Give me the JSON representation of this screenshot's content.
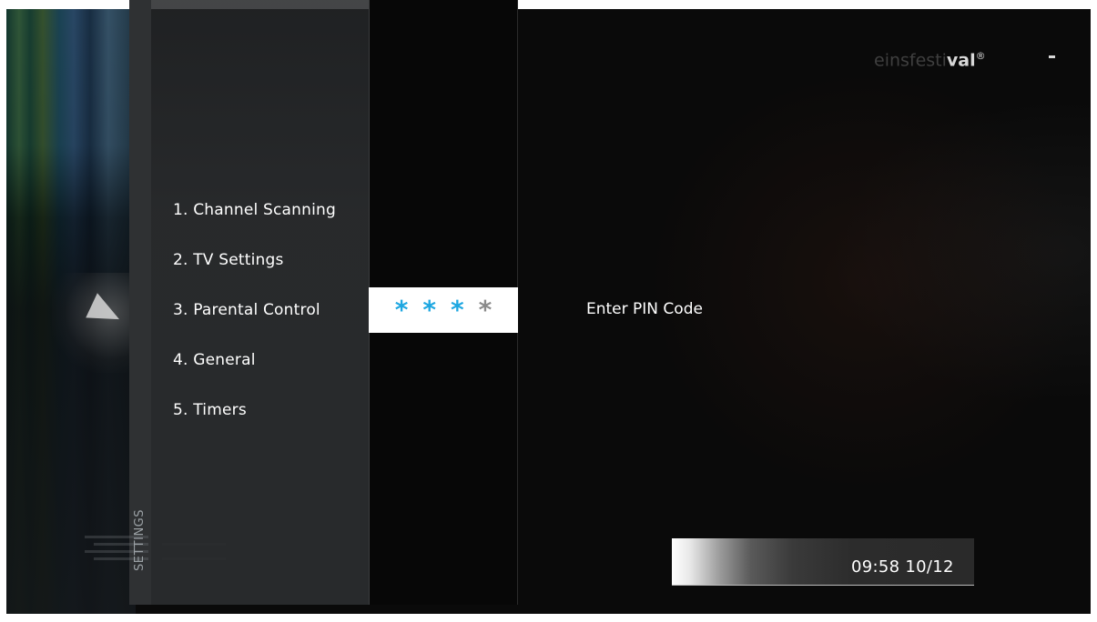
{
  "sidebar": {
    "title": "SETTINGS"
  },
  "menu": {
    "items": [
      {
        "label": "1. Channel Scanning"
      },
      {
        "label": "2. TV Settings"
      },
      {
        "label": "3. Parental Control"
      },
      {
        "label": "4. General"
      },
      {
        "label": "5. Timers"
      }
    ],
    "selected_index": 2
  },
  "pin": {
    "prompt": "Enter PIN Code",
    "entered_digits": 3,
    "total_digits": 4,
    "mask_char": "*",
    "active_color": "#1ea7e1",
    "inactive_color": "#8a8a8a"
  },
  "channel": {
    "logo_light": "einsfesti",
    "logo_bold": "val",
    "logo_mark": "®"
  },
  "status": {
    "clock": "09:58 10/12"
  }
}
